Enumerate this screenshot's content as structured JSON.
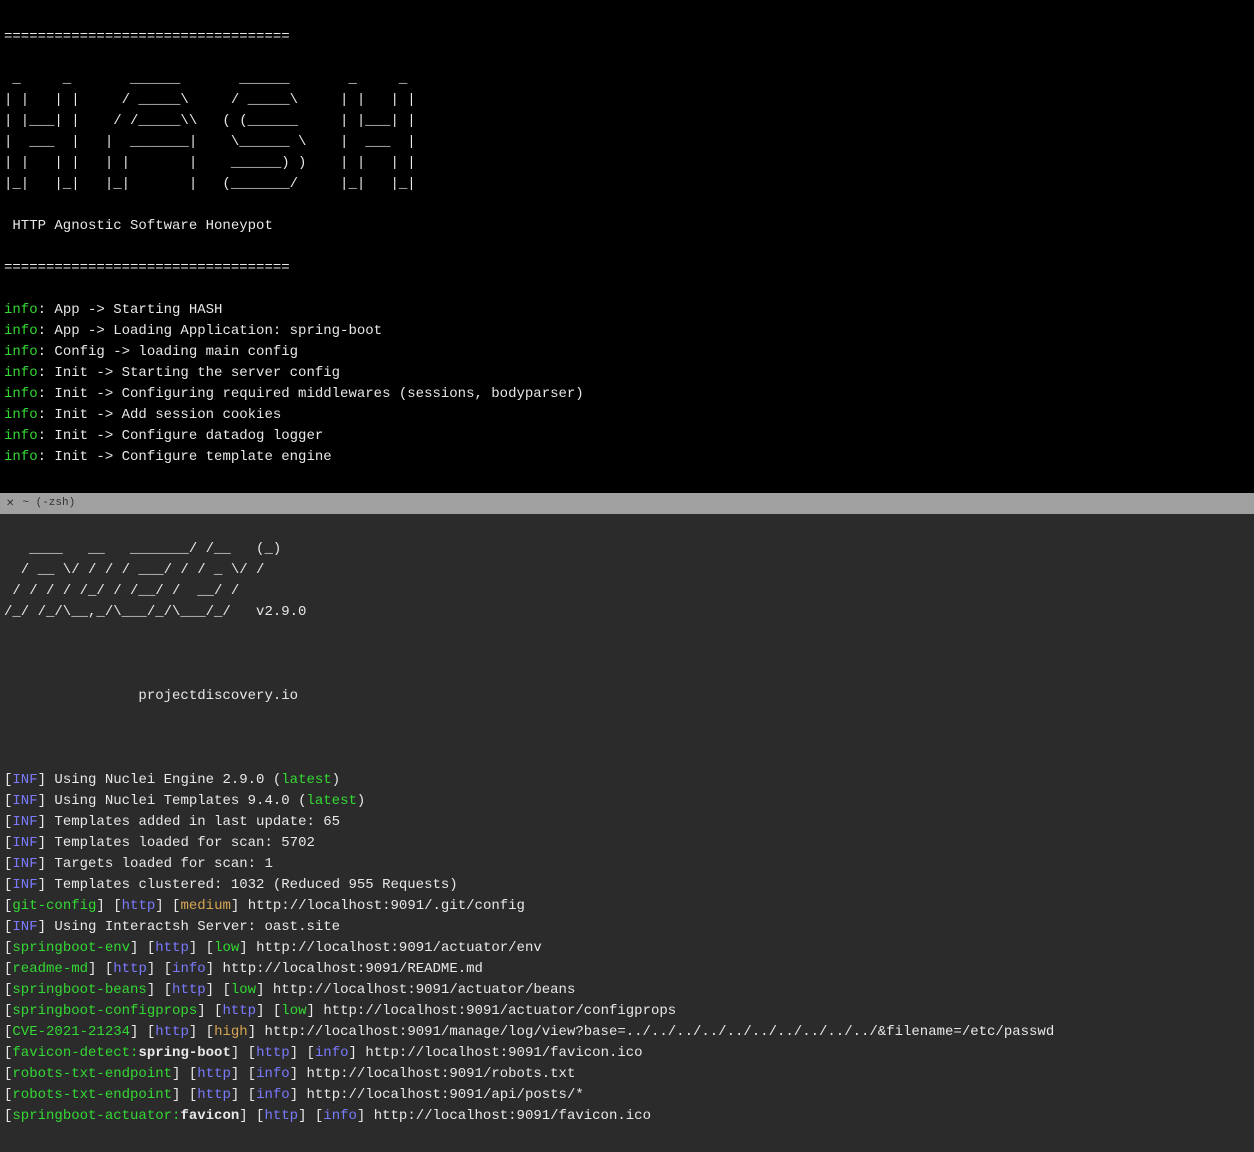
{
  "top": {
    "hr": "==================================",
    "banner": " _     _       ______       ______       _     _\n| |   | |     / _____\\     / _____\\     | |   | |\n| |___| |    / /_____\\\\   ( (______     | |___| |\n|  ___  |   |  _______|    \\______ \\    |  ___  |\n| |   | |   | |       |    ______) )    | |   | |\n|_|   |_|   |_|       |   (_______/     |_|   |_|",
    "subtitle": " HTTP Agnostic Software Honeypot",
    "loglabel": "info",
    "logs": [
      ": App -> Starting HASH",
      ": App -> Loading Application: spring-boot",
      ": Config -> loading main config",
      ": Init -> Starting the server config",
      ": Init -> Configuring required middlewares (sessions, bodyparser)",
      ": Init -> Add session cookies",
      ": Init -> Configure datadog logger",
      ": Init -> Configure template engine"
    ]
  },
  "divider": {
    "close": "✕",
    "title": "~ (-zsh)"
  },
  "bottom": {
    "banner": "   ____   __   _______/ /__   (_)\n  / __ \\/ / / / ___/ / / _ \\/ /\n / / / / /_/ / /__/ /  __/ /\n/_/ /_/\\__,_/\\___/_/\\___/_/   v2.9.0",
    "tagline": "                projectdiscovery.io",
    "inf_label": "INF",
    "latest_label": "latest",
    "inf_engine_a": "] Using Nuclei Engine 2.9.0 (",
    "inf_engine_b": ")",
    "inf_tpl_a": "] Using Nuclei Templates 9.4.0 (",
    "inf_tpl_b": ")",
    "inf3": "] Templates added in last update: 65",
    "inf4": "] Templates loaded for scan: 5702",
    "inf5": "] Targets loaded for scan: 1",
    "inf6": "] Templates clustered: 1032 (Reduced 955 Requests)",
    "inf7": "] Using Interactsh Server: oast.site",
    "http": "http",
    "sev": {
      "info": "info",
      "low": "low",
      "medium": "medium",
      "high": "high"
    },
    "findings": [
      {
        "name": "git-config",
        "proto": "http",
        "sev": "medium",
        "url": "http://localhost:9091/.git/config",
        "after_inf": false
      },
      {
        "name": "springboot-env",
        "proto": "http",
        "sev": "low",
        "url": "http://localhost:9091/actuator/env",
        "after_inf": true
      },
      {
        "name": "readme-md",
        "proto": "http",
        "sev": "info",
        "url": "http://localhost:9091/README.md",
        "after_inf": false
      },
      {
        "name": "springboot-beans",
        "proto": "http",
        "sev": "low",
        "url": "http://localhost:9091/actuator/beans",
        "after_inf": false
      },
      {
        "name": "springboot-configprops",
        "proto": "http",
        "sev": "low",
        "url": "http://localhost:9091/actuator/configprops",
        "after_inf": false
      },
      {
        "name": "CVE-2021-21234",
        "proto": "http",
        "sev": "high",
        "url": "http://localhost:9091/manage/log/view?base=../../../../../../../../../../&filename=/etc/passwd",
        "after_inf": false
      },
      {
        "name": "favicon-detect:spring-boot",
        "proto": "http",
        "sev": "info",
        "url": "http://localhost:9091/favicon.ico",
        "after_inf": false,
        "two_color": true,
        "name_a": "favicon-detect:",
        "name_b": "spring-boot"
      },
      {
        "name": "robots-txt-endpoint",
        "proto": "http",
        "sev": "info",
        "url": "http://localhost:9091/robots.txt",
        "after_inf": false
      },
      {
        "name": "robots-txt-endpoint",
        "proto": "http",
        "sev": "info",
        "url": "http://localhost:9091/api/posts/*",
        "after_inf": false
      },
      {
        "name": "springboot-actuator:favicon",
        "proto": "http",
        "sev": "info",
        "url": "http://localhost:9091/favicon.ico",
        "after_inf": false,
        "two_color": true,
        "name_a": "springboot-actuator:",
        "name_b": "favicon"
      }
    ]
  }
}
